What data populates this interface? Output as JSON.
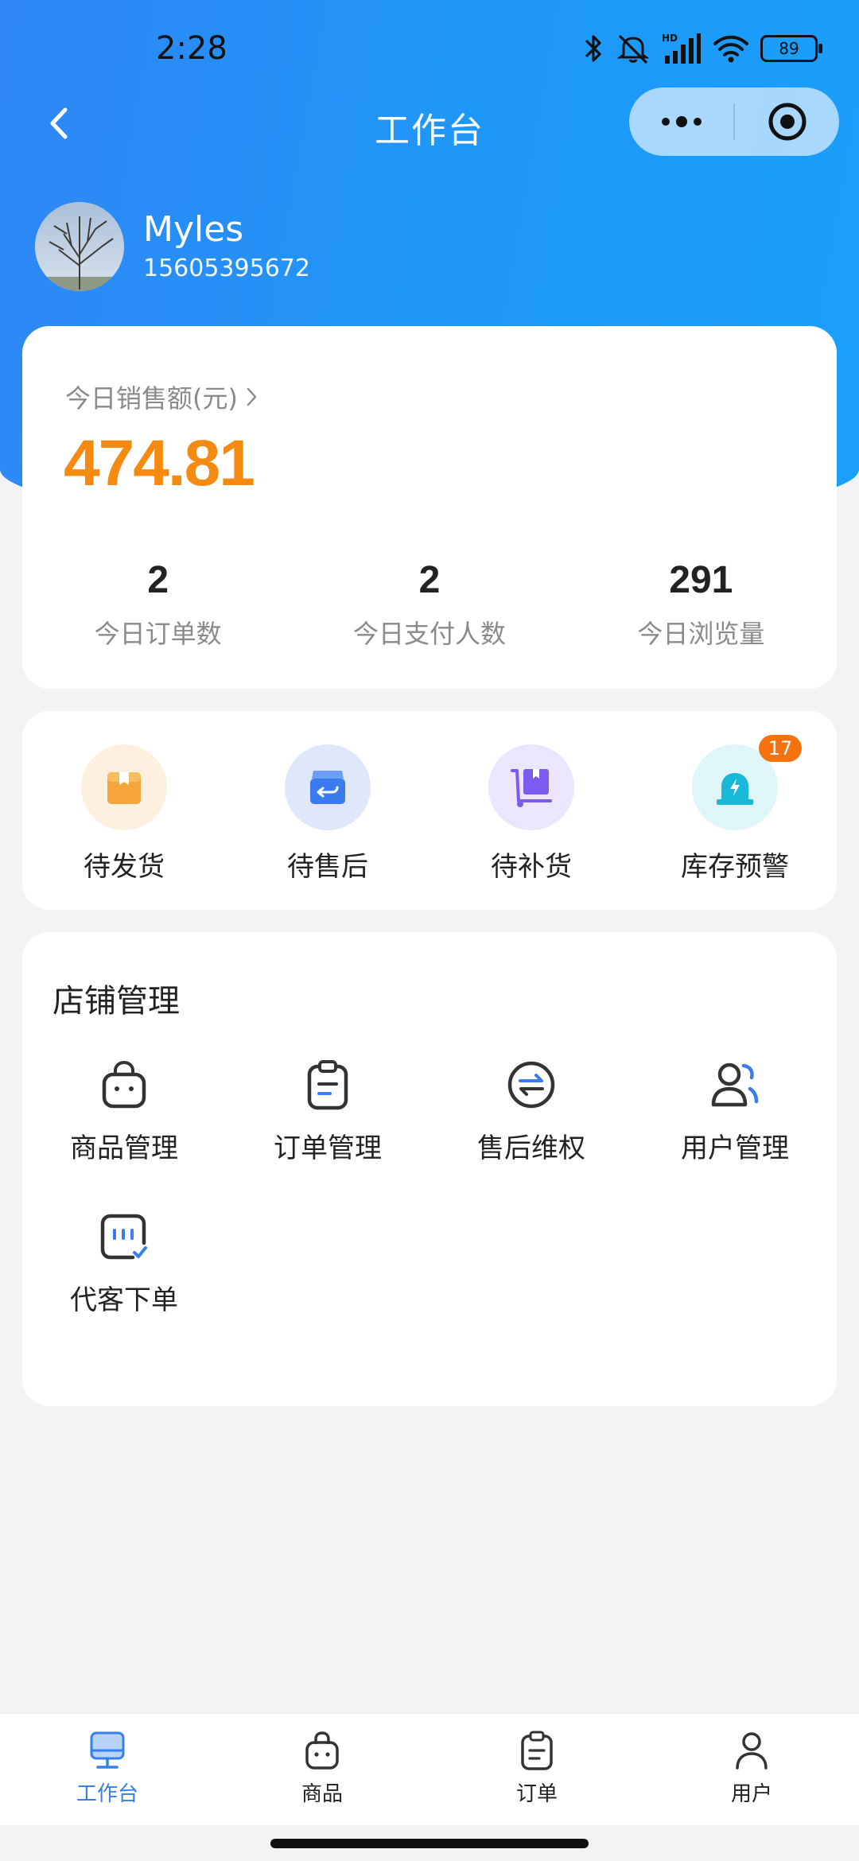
{
  "status_bar": {
    "time": "2:28",
    "network_label": "HD",
    "battery": "89"
  },
  "nav": {
    "title": "工作台"
  },
  "user": {
    "name": "Myles",
    "phone": "15605395672"
  },
  "sales": {
    "label": "今日销售额(元)",
    "amount": "474.81",
    "stats": [
      {
        "value": "2",
        "label": "今日订单数"
      },
      {
        "value": "2",
        "label": "今日支付人数"
      },
      {
        "value": "291",
        "label": "今日浏览量"
      }
    ]
  },
  "quick_actions": [
    {
      "label": "待发货",
      "icon": "box-icon",
      "color": "#f5a53a",
      "bg": "#fdf0de"
    },
    {
      "label": "待售后",
      "icon": "return-icon",
      "color": "#3a7bf0",
      "bg": "#dfe8fb"
    },
    {
      "label": "待补货",
      "icon": "cart-restock-icon",
      "color": "#7c5cf0",
      "bg": "#ebe6fd"
    },
    {
      "label": "库存预警",
      "icon": "alarm-icon",
      "color": "#18b8d8",
      "bg": "#def5fa",
      "badge": "17"
    }
  ],
  "manage": {
    "title": "店铺管理",
    "items": [
      {
        "label": "商品管理",
        "icon": "shopping-bag-icon"
      },
      {
        "label": "订单管理",
        "icon": "clipboard-icon"
      },
      {
        "label": "售后维权",
        "icon": "exchange-icon"
      },
      {
        "label": "用户管理",
        "icon": "users-icon"
      },
      {
        "label": "代客下单",
        "icon": "chat-order-icon"
      }
    ]
  },
  "tabs": [
    {
      "label": "工作台",
      "icon": "monitor-icon",
      "active": true
    },
    {
      "label": "商品",
      "icon": "shopping-bag-icon"
    },
    {
      "label": "订单",
      "icon": "clipboard-icon"
    },
    {
      "label": "用户",
      "icon": "user-icon"
    }
  ],
  "colors": {
    "header_start": "#2f86f6",
    "header_end": "#1aa0fb",
    "amount": "#f58a10",
    "active_tab": "#3481ea",
    "badge": "#f5720f"
  }
}
